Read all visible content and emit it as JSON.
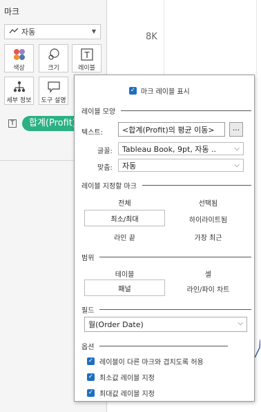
{
  "marks_pane": {
    "title": "마크",
    "mark_type": "자동",
    "tiles": [
      {
        "label": "색상",
        "icon": "color-icon"
      },
      {
        "label": "크기",
        "icon": "size-icon"
      },
      {
        "label": "레이블",
        "icon": "label-icon"
      },
      {
        "label": "세부 정보",
        "icon": "detail-icon"
      },
      {
        "label": "도구 설명",
        "icon": "tooltip-icon"
      }
    ],
    "pill_label": "합계(Profit)",
    "pill_type_icon": "T"
  },
  "chart": {
    "axis_tick": "8K"
  },
  "label_popup": {
    "show_labels": "마크 레이블 표시",
    "section_appearance": "레이블 모양",
    "text_label": "텍스트:",
    "text_value": "<합계(Profit)의 평균 이동>",
    "text_button": "...",
    "font_label": "글꼴:",
    "font_value": "Tableau Book, 9pt, 자동 ..",
    "align_label": "맞춤:",
    "align_value": "자동",
    "section_marks": "레이블 지정할 마크",
    "marks_options": {
      "all": "전체",
      "selected": "선택됨",
      "min_max": "최소/최대",
      "highlighted": "하이라이트됨",
      "line_ends": "라인 끝",
      "most_recent": "가장 최근"
    },
    "section_scope": "범위",
    "scope_options": {
      "table": "테이블",
      "cell": "셀",
      "pane": "패널",
      "line_pie_chart": "라인/파이 차트"
    },
    "section_field": "필드",
    "field_value": "월(Order Date)",
    "section_options": "옵션",
    "options": [
      "레이블이 다른 마크와 겹치도록 허용",
      "최소값 레이블 지정",
      "최대값 레이블 지정"
    ],
    "checkmark": "✓"
  },
  "colors": {
    "pill": "#2bb184",
    "checkbox": "#1f6fbf",
    "line": "#3b5fb0"
  }
}
